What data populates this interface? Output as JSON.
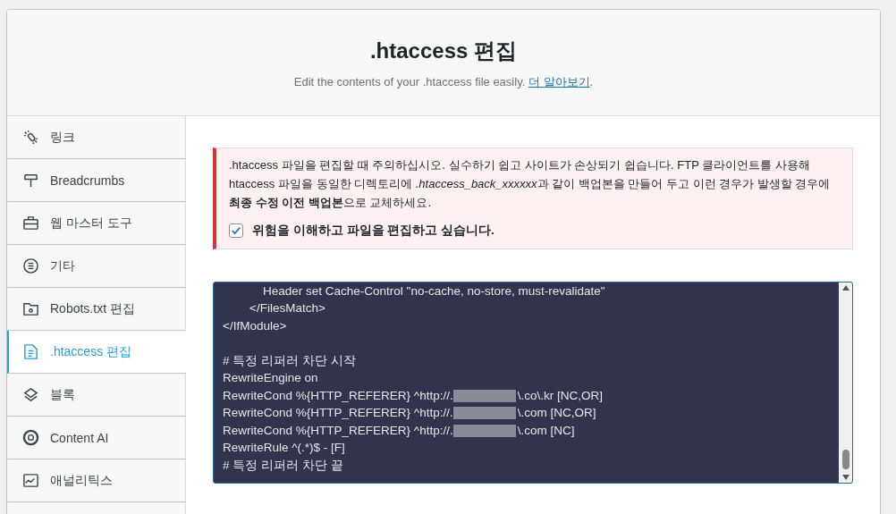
{
  "header": {
    "title": ".htaccess 편집",
    "subtitle": "Edit the contents of your .htaccess file easily.",
    "link": "더 알아보기",
    "after_link": "."
  },
  "sidebar": {
    "items": [
      {
        "label": "링크",
        "selected": false
      },
      {
        "label": "Breadcrumbs",
        "selected": false
      },
      {
        "label": "웹 마스터 도구",
        "selected": false
      },
      {
        "label": "기타",
        "selected": false
      },
      {
        "label": "Robots.txt 편집",
        "selected": false
      },
      {
        "label": ".htaccess 편집",
        "selected": true
      },
      {
        "label": "블록",
        "selected": false
      },
      {
        "label": "Content AI",
        "selected": false
      },
      {
        "label": "애널리틱스",
        "selected": false
      }
    ]
  },
  "warning": {
    "parts": [
      {
        "kind": "plain",
        "text": ".htaccess 파일을 편집할 때 주의하십시오. 실수하기 쉽고 사이트가 손상되기 쉽습니다. FTP 클라이언트를 사용해 htaccess 파일을 동일한 디렉토리에 "
      },
      {
        "kind": "italic",
        "text": ".htaccess_back_xxxxxx"
      },
      {
        "kind": "plain",
        "text": "과 같이 백업본을 만들어 두고 이런 경우가 발생할 경우에 "
      },
      {
        "kind": "bold",
        "text": "최종 수정 이전 백업본"
      },
      {
        "kind": "plain",
        "text": "으로 교체하세요."
      }
    ],
    "confirm": {
      "label": "위험을 이해하고 파일을 편집하고 싶습니다.",
      "checked": true
    }
  },
  "editor": {
    "lines": [
      {
        "kind": "text",
        "text": "            Header set Cache-Control \"no-cache, no-store, must-revalidate\""
      },
      {
        "kind": "text",
        "text": "        </FilesMatch>"
      },
      {
        "kind": "text",
        "text": "</IfModule>"
      },
      {
        "kind": "blank"
      },
      {
        "kind": "text",
        "text": "# 특정 리퍼러 차단 시작"
      },
      {
        "kind": "text",
        "text": "RewriteEngine on"
      },
      {
        "kind": "redacted",
        "text": "RewriteCond %{HTTP_REFERER} ^http://.",
        "after": "\\.co\\.kr [NC,OR]"
      },
      {
        "kind": "redacted",
        "text": "RewriteCond %{HTTP_REFERER} ^http://.",
        "after": "\\.com [NC,OR]"
      },
      {
        "kind": "redacted",
        "text": "RewriteCond %{HTTP_REFERER} ^http://.",
        "after": "\\.com [NC]"
      },
      {
        "kind": "text",
        "text": "RewriteRule ^(.*)$ - [F]"
      },
      {
        "kind": "text",
        "text": "# 특정 리퍼러 차단 끝"
      }
    ]
  }
}
